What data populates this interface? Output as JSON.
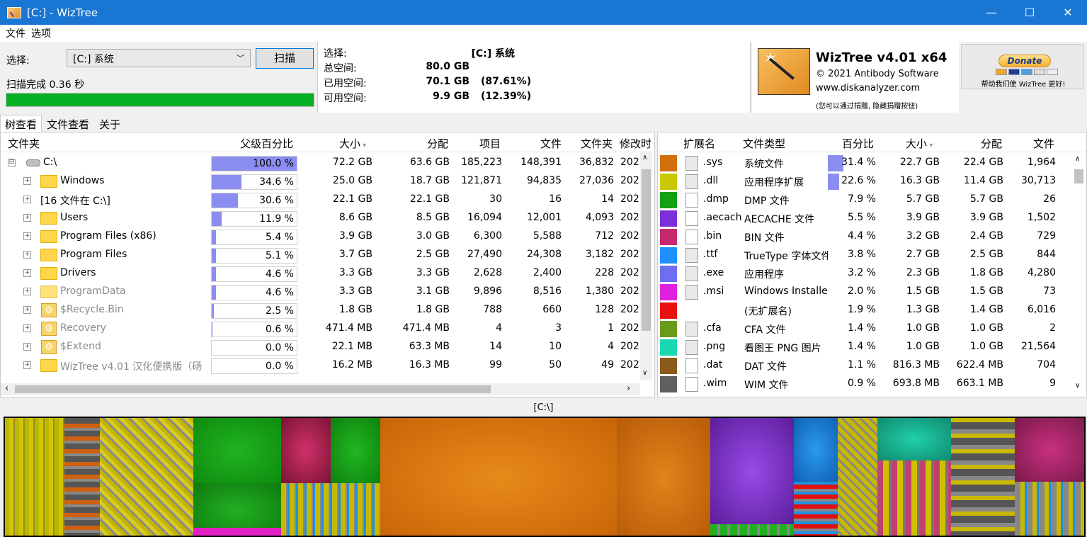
{
  "window": {
    "title": "[C:]  - WizTree",
    "minimize": "—",
    "maximize": "☐",
    "close": "✕"
  },
  "menu": [
    "文件",
    "选项"
  ],
  "scan": {
    "select_label": "选择:",
    "drive": "[C:] 系统",
    "button": "扫描",
    "status": "扫描完成 0.36 秒",
    "progress": 1.0
  },
  "info": {
    "select_label": "选择:",
    "select_value": "[C:]  系统",
    "total_label": "总空间:",
    "total_value": "80.0 GB",
    "used_label": "已用空间:",
    "used_value": "70.1 GB",
    "used_pct": "(87.61%)",
    "free_label": "可用空间:",
    "free_value": "9.9 GB",
    "free_pct": "(12.39%)"
  },
  "brand": {
    "title": "WizTree v4.01 x64",
    "copyright": "© 2021 Antibody Software",
    "url": "www.diskanalyzer.com",
    "note": "(您可以通过捐赠, 隐藏捐赠按钮)"
  },
  "donate": {
    "button": "Donate",
    "text": "帮助我们使 WizTree 更好!"
  },
  "tabs": [
    "树查看",
    "文件查看",
    "关于"
  ],
  "tree": {
    "headers": {
      "folder": "文件夹",
      "pct": "父级百分比",
      "size": "大小",
      "alloc": "分配",
      "items": "项目",
      "files": "文件",
      "folders": "文件夹",
      "modified": "修改时"
    },
    "rows": [
      {
        "name": "C:\\",
        "pct": "100.0 %",
        "fill": 1.0,
        "size": "72.2 GB",
        "alloc": "63.6 GB",
        "items": "185,223",
        "files": "148,391",
        "folders": "36,832",
        "mod": "202",
        "icon": "drive",
        "gray": false,
        "indent": 0,
        "exp": "⊟"
      },
      {
        "name": "Windows",
        "pct": "34.6 %",
        "fill": 0.346,
        "size": "25.0 GB",
        "alloc": "18.7 GB",
        "items": "121,871",
        "files": "94,835",
        "folders": "27,036",
        "mod": "202",
        "icon": "folder",
        "gray": false,
        "indent": 1,
        "exp": "+"
      },
      {
        "name": "[16 文件在 C:\\]",
        "pct": "30.6 %",
        "fill": 0.306,
        "size": "22.1 GB",
        "alloc": "22.1 GB",
        "items": "30",
        "files": "16",
        "folders": "14",
        "mod": "202",
        "icon": "none",
        "gray": false,
        "indent": 1,
        "exp": "+"
      },
      {
        "name": "Users",
        "pct": "11.9 %",
        "fill": 0.119,
        "size": "8.6 GB",
        "alloc": "8.5 GB",
        "items": "16,094",
        "files": "12,001",
        "folders": "4,093",
        "mod": "202",
        "icon": "folder",
        "gray": false,
        "indent": 1,
        "exp": "+"
      },
      {
        "name": "Program Files (x86)",
        "pct": "5.4 %",
        "fill": 0.054,
        "size": "3.9 GB",
        "alloc": "3.0 GB",
        "items": "6,300",
        "files": "5,588",
        "folders": "712",
        "mod": "202",
        "icon": "folder",
        "gray": false,
        "indent": 1,
        "exp": "+"
      },
      {
        "name": "Program Files",
        "pct": "5.1 %",
        "fill": 0.051,
        "size": "3.7 GB",
        "alloc": "2.5 GB",
        "items": "27,490",
        "files": "24,308",
        "folders": "3,182",
        "mod": "202",
        "icon": "folder",
        "gray": false,
        "indent": 1,
        "exp": "+"
      },
      {
        "name": "Drivers",
        "pct": "4.6 %",
        "fill": 0.046,
        "size": "3.3 GB",
        "alloc": "3.3 GB",
        "items": "2,628",
        "files": "2,400",
        "folders": "228",
        "mod": "202",
        "icon": "folder",
        "gray": false,
        "indent": 1,
        "exp": "+"
      },
      {
        "name": "ProgramData",
        "pct": "4.6 %",
        "fill": 0.046,
        "size": "3.3 GB",
        "alloc": "3.1 GB",
        "items": "9,896",
        "files": "8,516",
        "folders": "1,380",
        "mod": "202",
        "icon": "folder-light",
        "gray": true,
        "indent": 1,
        "exp": "+"
      },
      {
        "name": "$Recycle.Bin",
        "pct": "2.5 %",
        "fill": 0.025,
        "size": "1.8 GB",
        "alloc": "1.8 GB",
        "items": "788",
        "files": "660",
        "folders": "128",
        "mod": "202",
        "icon": "gear",
        "gray": true,
        "indent": 1,
        "exp": "+"
      },
      {
        "name": "Recovery",
        "pct": "0.6 %",
        "fill": 0.006,
        "size": "471.4 MB",
        "alloc": "471.4 MB",
        "items": "4",
        "files": "3",
        "folders": "1",
        "mod": "202",
        "icon": "gear",
        "gray": true,
        "indent": 1,
        "exp": "+"
      },
      {
        "name": "$Extend",
        "pct": "0.0 %",
        "fill": 0.0,
        "size": "22.1 MB",
        "alloc": "63.3 MB",
        "items": "14",
        "files": "10",
        "folders": "4",
        "mod": "202",
        "icon": "gear",
        "gray": true,
        "indent": 1,
        "exp": "+"
      },
      {
        "name": "WizTree v4.01 汉化便携版（砀",
        "pct": "0.0 %",
        "fill": 0.0,
        "size": "16.2 MB",
        "alloc": "16.3 MB",
        "items": "99",
        "files": "50",
        "folders": "49",
        "mod": "202",
        "icon": "folder",
        "gray": true,
        "indent": 1,
        "exp": "+"
      }
    ]
  },
  "types": {
    "headers": {
      "ext": "扩展名",
      "type": "文件类型",
      "pct": "百分比",
      "size": "大小",
      "alloc": "分配",
      "files": "文件"
    },
    "rows": [
      {
        "color": "#d2700a",
        "ext": ".sys",
        "type": "系统文件",
        "pct": "31.4 %",
        "fill": 0.314,
        "size": "22.7 GB",
        "alloc": "22.4 GB",
        "files": "1,964",
        "icon": "img"
      },
      {
        "color": "#c8c800",
        "ext": ".dll",
        "type": "应用程序扩展",
        "pct": "22.6 %",
        "fill": 0.226,
        "size": "16.3 GB",
        "alloc": "11.4 GB",
        "files": "30,713",
        "icon": "img"
      },
      {
        "color": "#14a014",
        "ext": ".dmp",
        "type": "DMP 文件",
        "pct": "7.9 %",
        "fill": 0.0,
        "size": "5.7 GB",
        "alloc": "5.7 GB",
        "files": "26",
        "icon": "blank"
      },
      {
        "color": "#7b2fd8",
        "ext": ".aecach",
        "type": "AECACHE 文件",
        "pct": "5.5 %",
        "fill": 0.0,
        "size": "3.9 GB",
        "alloc": "3.9 GB",
        "files": "1,502",
        "icon": "blank"
      },
      {
        "color": "#c8286e",
        "ext": ".bin",
        "type": "BIN 文件",
        "pct": "4.4 %",
        "fill": 0.0,
        "size": "3.2 GB",
        "alloc": "2.4 GB",
        "files": "729",
        "icon": "blank"
      },
      {
        "color": "#1e90ff",
        "ext": ".ttf",
        "type": "TrueType 字体文件",
        "pct": "3.8 %",
        "fill": 0.0,
        "size": "2.7 GB",
        "alloc": "2.5 GB",
        "files": "844",
        "icon": "img"
      },
      {
        "color": "#6e6ef0",
        "ext": ".exe",
        "type": "应用程序",
        "pct": "3.2 %",
        "fill": 0.0,
        "size": "2.3 GB",
        "alloc": "1.8 GB",
        "files": "4,280",
        "icon": "img"
      },
      {
        "color": "#e020e0",
        "ext": ".msi",
        "type": "Windows Installer",
        "pct": "2.0 %",
        "fill": 0.0,
        "size": "1.5 GB",
        "alloc": "1.5 GB",
        "files": "73",
        "icon": "img"
      },
      {
        "color": "#e81010",
        "ext": "",
        "type": "(无扩展名)",
        "pct": "1.9 %",
        "fill": 0.0,
        "size": "1.3 GB",
        "alloc": "1.4 GB",
        "files": "6,016",
        "icon": "none"
      },
      {
        "color": "#6a9a1a",
        "ext": ".cfa",
        "type": "CFA 文件",
        "pct": "1.4 %",
        "fill": 0.0,
        "size": "1.0 GB",
        "alloc": "1.0 GB",
        "files": "2",
        "icon": "img"
      },
      {
        "color": "#18d8b0",
        "ext": ".png",
        "type": "看图王 PNG 图片",
        "pct": "1.4 %",
        "fill": 0.0,
        "size": "1.0 GB",
        "alloc": "1.0 GB",
        "files": "21,564",
        "icon": "img"
      },
      {
        "color": "#8a5a1a",
        "ext": ".dat",
        "type": "DAT 文件",
        "pct": "1.1 %",
        "fill": 0.0,
        "size": "816.3 MB",
        "alloc": "622.4 MB",
        "files": "704",
        "icon": "blank"
      },
      {
        "color": "#606060",
        "ext": ".wim",
        "type": "WIM 文件",
        "pct": "0.9 %",
        "fill": 0.0,
        "size": "693.8 MB",
        "alloc": "663.1 MB",
        "files": "9",
        "icon": "blank"
      }
    ]
  },
  "treemap_label": "[C:\\]"
}
